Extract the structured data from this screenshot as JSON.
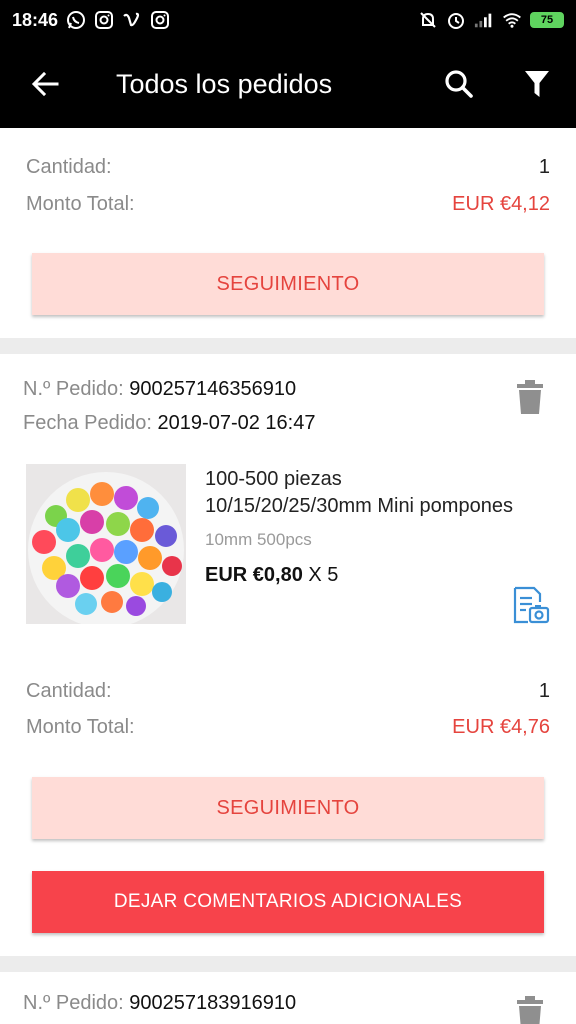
{
  "status_bar": {
    "time": "18:46",
    "battery": "75",
    "left_icons": [
      "whatsapp-icon",
      "instagram-icon",
      "vimeo-icon",
      "instagram-icon"
    ],
    "right_icons": [
      "mute-icon",
      "alarm-icon",
      "signal-icon",
      "wifi-icon",
      "battery-icon"
    ]
  },
  "app_bar": {
    "title": "Todos los pedidos",
    "icons": [
      "back-arrow-icon",
      "search-icon",
      "filter-icon"
    ]
  },
  "colors": {
    "accent": "#e5443e",
    "track_button_bg": "#ffdcd7",
    "feedback_button_bg": "#f7434b",
    "app_bar_bg": "#000000"
  },
  "orders": [
    {
      "quantity_label": "Cantidad:",
      "quantity": "1",
      "total_label": "Monto Total:",
      "total": "EUR €4,12",
      "track_label": "SEGUIMIENTO"
    },
    {
      "order_no_label": "N.º Pedido:",
      "order_no": "900257146356910",
      "date_label": "Fecha Pedido:",
      "date": "2019-07-02 16:47",
      "product_title_line1": "100-500 piezas",
      "product_title_line2": "10/15/20/25/30mm Mini pompones",
      "variant": "10mm 500pcs",
      "price": "EUR €0,80",
      "qty_text": " X 5",
      "quantity_label": "Cantidad:",
      "quantity": "1",
      "total_label": "Monto Total:",
      "total": "EUR €4,76",
      "track_label": "SEGUIMIENTO",
      "feedback_label": "DEJAR COMENTARIOS ADICIONALES"
    },
    {
      "order_no_label": "N.º Pedido:",
      "order_no": "900257183916910"
    }
  ]
}
